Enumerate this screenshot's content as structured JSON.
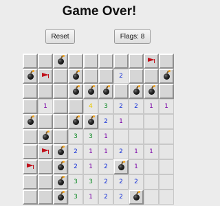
{
  "header": {
    "title": "Game Over!"
  },
  "controls": {
    "reset_label": "Reset",
    "flags_label": "Flags: 8"
  },
  "colors": {
    "1": "#7a00a8",
    "2": "#1530d8",
    "3": "#0e8a25",
    "4": "#e9c800"
  },
  "icons": {
    "mine": "bomb-icon",
    "flag": "flag-icon"
  },
  "board": {
    "rows": 10,
    "cols": 10,
    "cells": [
      [
        "C",
        "C",
        "M",
        "C",
        "C",
        "C",
        "C",
        "C",
        "F",
        "C"
      ],
      [
        "M",
        "F",
        "C",
        "M",
        "C",
        "C",
        "2",
        "C",
        "C",
        "M"
      ],
      [
        "C",
        "C",
        "C",
        "M",
        "M",
        "M",
        "C",
        "M",
        "M",
        "C"
      ],
      [
        "C",
        "1",
        "C",
        "C",
        "4",
        "3",
        "2",
        "2",
        "1",
        "1"
      ],
      [
        "M",
        "C",
        "C",
        "M",
        "M",
        "2",
        "1",
        "",
        "",
        ""
      ],
      [
        "C",
        "M",
        "C",
        "3",
        "3",
        "1",
        "",
        "",
        "",
        ""
      ],
      [
        "C",
        "F",
        "M",
        "2",
        "1",
        "1",
        "2",
        "1",
        "1",
        ""
      ],
      [
        "F",
        "C",
        "M",
        "2",
        "1",
        "2",
        "M",
        "1",
        "",
        ""
      ],
      [
        "C",
        "C",
        "M",
        "3",
        "3",
        "2",
        "2",
        "2",
        "",
        ""
      ],
      [
        "C",
        "C",
        "M",
        "3",
        "1",
        "2",
        "2",
        "M",
        "",
        ""
      ]
    ]
  }
}
